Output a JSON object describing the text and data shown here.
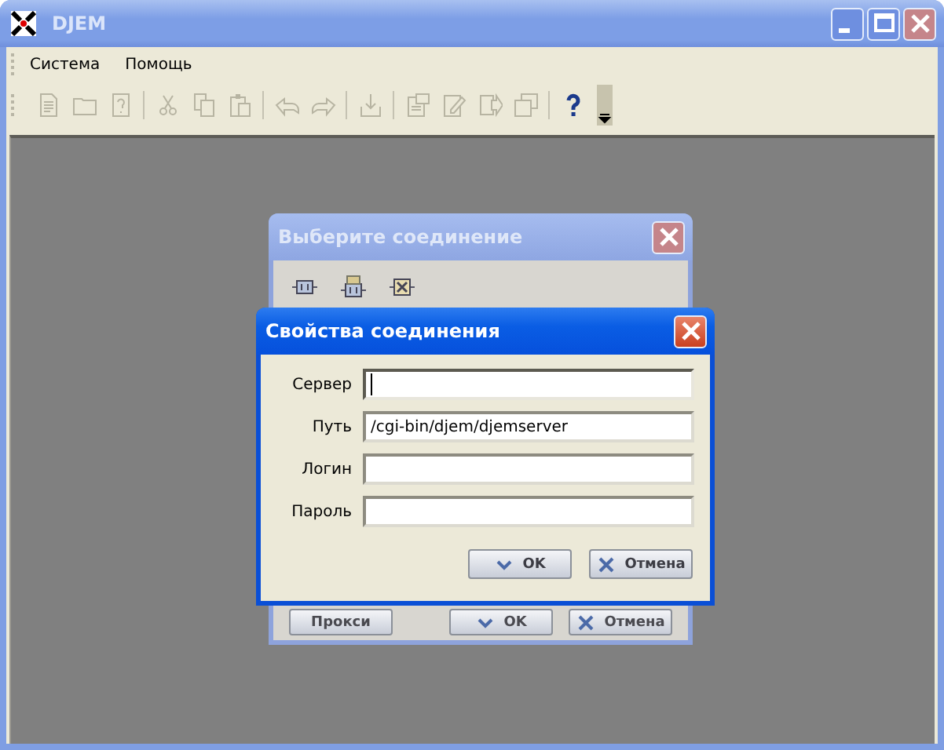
{
  "window": {
    "title": "DJEM",
    "active": false
  },
  "menu": [
    {
      "label": "Система"
    },
    {
      "label": "Помощь"
    }
  ],
  "toolbar": {
    "groups": [
      [
        {
          "kind": "document",
          "disabled": true
        },
        {
          "kind": "folder",
          "disabled": true
        },
        {
          "kind": "help-document",
          "disabled": true
        }
      ],
      [
        {
          "kind": "cut",
          "disabled": true
        },
        {
          "kind": "copy",
          "disabled": true
        },
        {
          "kind": "paste",
          "disabled": true
        }
      ],
      [
        {
          "kind": "undo",
          "disabled": true
        },
        {
          "kind": "redo",
          "disabled": true
        }
      ],
      [
        {
          "kind": "import",
          "disabled": true
        }
      ],
      [
        {
          "kind": "properties",
          "disabled": true
        },
        {
          "kind": "edit",
          "disabled": true
        },
        {
          "kind": "export",
          "disabled": true
        },
        {
          "kind": "windows",
          "disabled": true
        }
      ],
      [
        {
          "kind": "help",
          "disabled": false
        }
      ]
    ]
  },
  "dialogs": [
    {
      "title": "Выберите соединение",
      "active": false,
      "tools": [
        {
          "kind": "connection"
        },
        {
          "kind": "connection-edit"
        },
        {
          "kind": "connection-delete"
        }
      ],
      "buttons": [
        {
          "label": "Прокси",
          "kind": "plain"
        },
        {
          "label": "OK",
          "kind": "ok"
        },
        {
          "label": "Отмена",
          "kind": "cancel"
        }
      ]
    },
    {
      "title": "Свойства соединения",
      "active": true,
      "fields": [
        {
          "label": "Сервер",
          "focused": true
        },
        {
          "label": "Путь",
          "value": "/cgi-bin/djem/djemserver",
          "focused": false
        },
        {
          "label": "Логин",
          "focused": false
        },
        {
          "label": "Пароль",
          "focused": false
        }
      ],
      "buttons": [
        {
          "label": "OK",
          "kind": "ok"
        },
        {
          "label": "Отмена",
          "kind": "cancel"
        }
      ]
    }
  ]
}
